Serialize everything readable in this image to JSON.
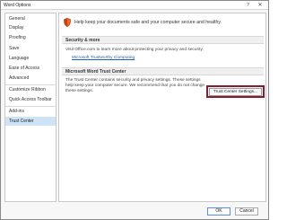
{
  "window": {
    "title": "Word Options",
    "help_glyph": "?",
    "close_glyph": "✕"
  },
  "sidebar": {
    "items": [
      {
        "label": "General"
      },
      {
        "label": "Display"
      },
      {
        "label": "Proofing"
      },
      {
        "label": "Save"
      },
      {
        "label": "Language"
      },
      {
        "label": "Ease of Access"
      },
      {
        "label": "Advanced"
      },
      {
        "label": "Customize Ribbon"
      },
      {
        "label": "Quick Access Toolbar"
      },
      {
        "label": "Add-ins"
      },
      {
        "label": "Trust Center",
        "selected": true
      }
    ]
  },
  "content": {
    "header_icon": "shield-icon",
    "header_text": "Help keep your documents safe and your computer secure and healthy.",
    "privacy_section": {
      "title": "Security & more",
      "text": "Visit Office.com to learn more about protecting your privacy and security.",
      "link": "Microsoft Trustworthy Computing"
    },
    "trust_section": {
      "title": "Microsoft Word Trust Center",
      "text_lines": [
        "The Trust Center contains security and privacy settings. These settings",
        "help keep your computer secure. We recommend that you do not change",
        "these settings."
      ],
      "button_label": "Trust Center Settings..."
    }
  },
  "footer": {
    "ok_label": "OK",
    "cancel_label": "Cancel"
  },
  "colors": {
    "highlight_border": "#8b1a2a",
    "link": "#2660b4",
    "selected_bg": "#cfe3f7",
    "shield_red": "#d83b01"
  }
}
